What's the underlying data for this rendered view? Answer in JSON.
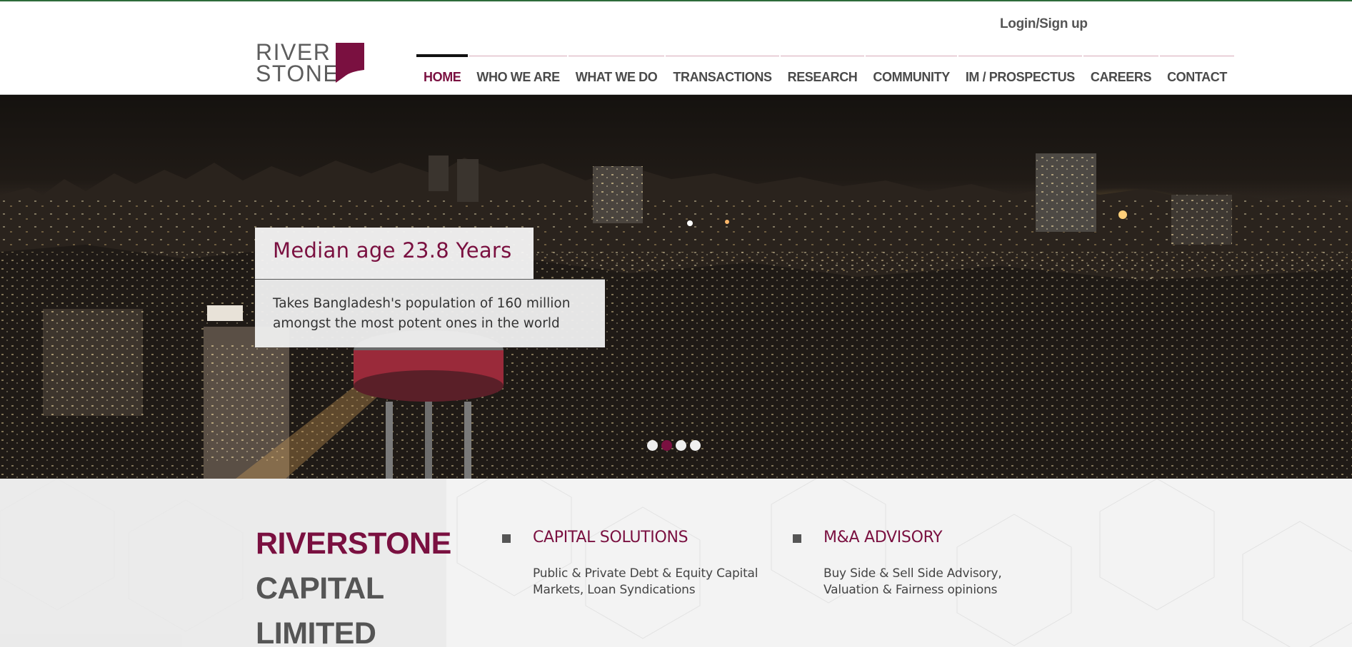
{
  "header": {
    "login_label": "Login/Sign up",
    "logo": {
      "line1": "RIVER",
      "line2": "STONE"
    },
    "nav": [
      {
        "label": "HOME",
        "active": true
      },
      {
        "label": "WHO WE ARE"
      },
      {
        "label": "WHAT WE DO"
      },
      {
        "label": "TRANSACTIONS"
      },
      {
        "label": "RESEARCH"
      },
      {
        "label": "COMMUNITY"
      },
      {
        "label": "IM / PROSPECTUS"
      },
      {
        "label": "CAREERS"
      },
      {
        "label": "CONTACT"
      }
    ]
  },
  "hero": {
    "caption_title": "Median age 23.8 Years",
    "caption_body": "Takes Bangladesh's population of 160 million amongst the most potent ones in the world",
    "slides_total": 4,
    "active_slide": 2
  },
  "company": {
    "line1": "RIVERSTONE",
    "line2": "CAPITAL",
    "line3": "LIMITED"
  },
  "services": [
    {
      "title": "CAPITAL SOLUTIONS",
      "desc": "Public & Private Debt & Equity Capital Markets, Loan Syndications"
    },
    {
      "title": "M&A ADVISORY",
      "desc": "Buy Side & Sell Side Advisory, Valuation & Fairness opinions"
    }
  ],
  "colors": {
    "brand": "#7a1040",
    "nav_text": "#4a4a4a",
    "top_accent": "#2e6b3a"
  }
}
